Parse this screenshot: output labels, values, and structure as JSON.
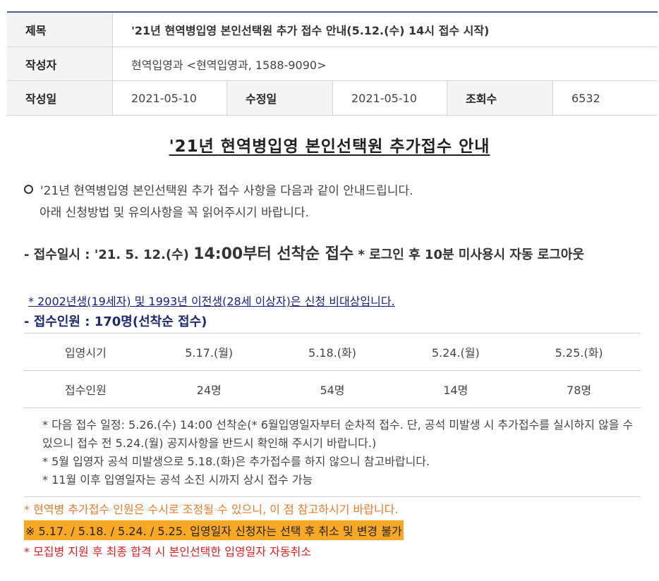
{
  "meta": {
    "subject_label": "제목",
    "subject_value": "'21년 현역병입영 본인선택원 추가 접수 안내(5.12.(수) 14시 접수 시작)",
    "author_label": "작성자",
    "author_value": "현역입영과 <현역입영과, 1588-9090>",
    "created_label": "작성일",
    "created_value": "2021-05-10",
    "modified_label": "수정일",
    "modified_value": "2021-05-10",
    "views_label": "조회수",
    "views_value": "6532"
  },
  "content": {
    "title": "'21년 현역병입영 본인선택원 추가접수 안내",
    "intro_line1": "'21년 현역병입영 본인선택원 추가 접수 사항을 다음과 같이 안내드립니다.",
    "intro_line2": "아래 신청방법 및 유의사항을 꼭 읽어주시기 바랍니다.",
    "reception_prefix": "- 접수일시 : '21. 5. 12.(수) ",
    "reception_time": "14:00부터 선착순 접수",
    "reception_suffix": " * 로그인 후 10분 미사용시 자동 로그아웃",
    "eligibility_note": " * 2002년생(19세자) 및 1993년 이전생(28세 이상자)은 신청 비대상입니다.",
    "count_line": "- 접수인원 : 170명(선착순 접수)"
  },
  "schedule_table": {
    "headers": [
      "입영시기",
      "5.17.(월)",
      "5.18.(화)",
      "5.24.(월)",
      "5.25.(화)"
    ],
    "row": [
      "접수인원",
      "24명",
      "54명",
      "14명",
      "78명"
    ]
  },
  "notes": [
    "* 다음 접수 일정: 5.26.(수) 14:00 선착순(* 6월입영일자부터 순차적 접수. 단, 공석 미발생 시 추가접수를 실시하지 않을 수 있으니 접수 전 5.24.(월) 공지사항을 반드시 확인해 주시기 바랍니다.)",
    "* 5월 입영자 공석 미발생으로 5.18.(화)은 추가접수를 하지 않으니 참고바랍니다.",
    "* 11월 이후 입영일자는 공석 소진 시까지 상시 접수 가능"
  ],
  "warnings": {
    "adjust": "* 현역병  추가접수 인원은 수시로 조정될 수 있으니, 이 점 참고하시기 바랍니다.",
    "highlight": "※ 5.17. / 5.18. / 5.24. / 5.25. 입영일자 신청자는 선택 후 취소 및 변경 불가",
    "recruit": "* 모집병 지원 후 최종 합격 시 본인선택한 입영일자 자동취소"
  },
  "colors": {
    "header_border": "#4a5f8a",
    "orange_text": "#e87a2a",
    "highlight_bg": "#f9a825",
    "red_text": "#e02020",
    "navy_text": "#1c2a6e"
  }
}
